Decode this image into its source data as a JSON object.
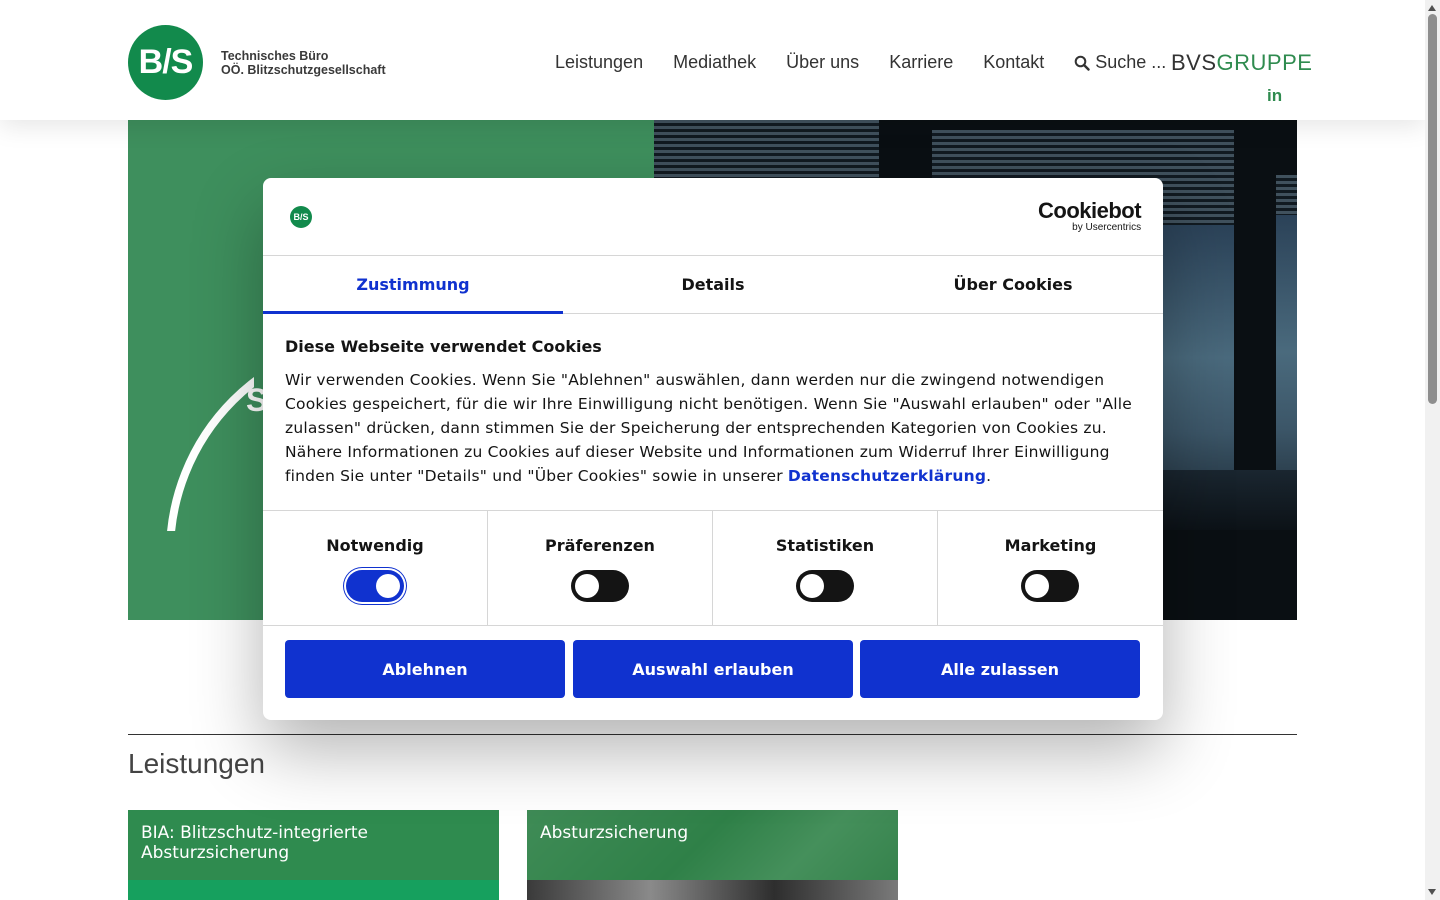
{
  "header": {
    "logo_mark": "B/S",
    "logo_line1": "Technisches Büro",
    "logo_line2": "OÖ. Blitzschutzgesellschaft",
    "nav": [
      "Leistungen",
      "Mediathek",
      "Über uns",
      "Karriere",
      "Kontakt"
    ],
    "search_label": "Suche ...",
    "group_brand_part1": "BVS",
    "group_brand_part2": "GRUPPE",
    "linkedin_label": "in"
  },
  "hero": {
    "partial_text": "S"
  },
  "section": {
    "title": "Leistungen",
    "cards": [
      {
        "title": "BIA: Blitzschutz-integrierte Absturzsicherung"
      },
      {
        "title": "Absturzsicherung"
      }
    ]
  },
  "cookie_dialog": {
    "logo_mark": "B/S",
    "provider_name": "Cookiebot",
    "provider_sub": "by Usercentrics",
    "tabs": [
      "Zustimmung",
      "Details",
      "Über Cookies"
    ],
    "active_tab": "Zustimmung",
    "heading": "Diese Webseite verwendet Cookies",
    "body_text": "Wir verwenden Cookies. Wenn Sie \"Ablehnen\" auswählen, dann werden nur die zwingend notwendigen Cookies gespeichert, für die wir Ihre Einwilligung nicht benötigen. Wenn Sie \"Auswahl erlauben\" oder \"Alle zulassen\" drücken, dann stimmen Sie der Speicherung der entsprechenden Kategorien von Cookies zu. Nähere Informationen zu Cookies auf dieser Website und Informationen zum Widerruf Ihrer Einwilligung finden Sie unter \"Details\" und \"Über Cookies\" sowie in unserer",
    "privacy_link": "Datenschutzerklärung",
    "body_end": ".",
    "categories": [
      {
        "label": "Notwendig",
        "enabled": true
      },
      {
        "label": "Präferenzen",
        "enabled": false
      },
      {
        "label": "Statistiken",
        "enabled": false
      },
      {
        "label": "Marketing",
        "enabled": false
      }
    ],
    "buttons": {
      "reject": "Ablehnen",
      "allow_selection": "Auswahl erlauben",
      "allow_all": "Alle zulassen"
    }
  },
  "colors": {
    "brand_green": "#128a4c",
    "hero_green": "#3e8f5d",
    "cookie_blue": "#1032cf"
  }
}
